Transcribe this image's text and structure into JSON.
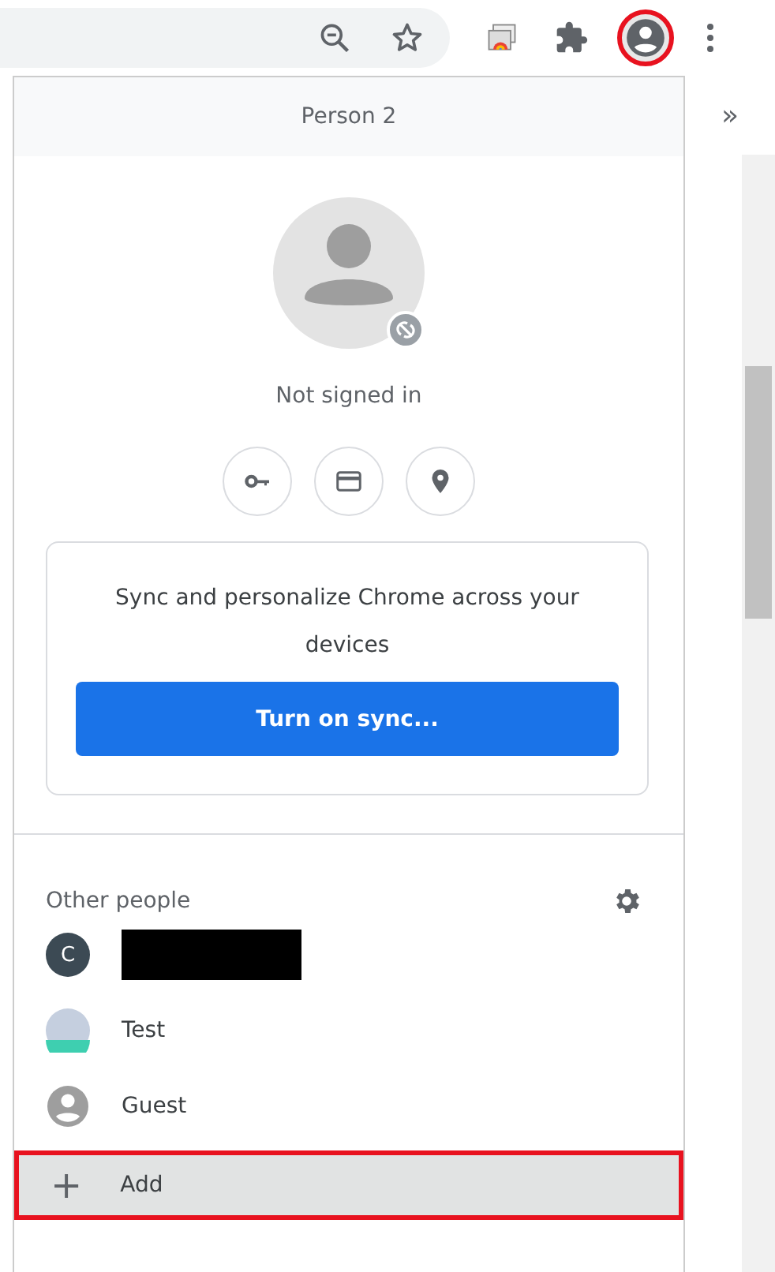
{
  "toolbar": {
    "profile_highlighted": true
  },
  "panel": {
    "title": "Person 2",
    "status": "Not signed in",
    "sync_off": true,
    "sync_card": {
      "text": "Sync and personalize Chrome across your devices",
      "button": "Turn on sync..."
    },
    "other_people": {
      "heading": "Other people",
      "people": [
        {
          "kind": "letter",
          "letter": "C",
          "redacted": true
        },
        {
          "kind": "photo",
          "name": "Test"
        },
        {
          "kind": "generic",
          "name": "Guest"
        }
      ],
      "add": {
        "icon": "+",
        "label": "Add",
        "highlighted": true
      }
    }
  },
  "bookmarks_overflow": "»"
}
